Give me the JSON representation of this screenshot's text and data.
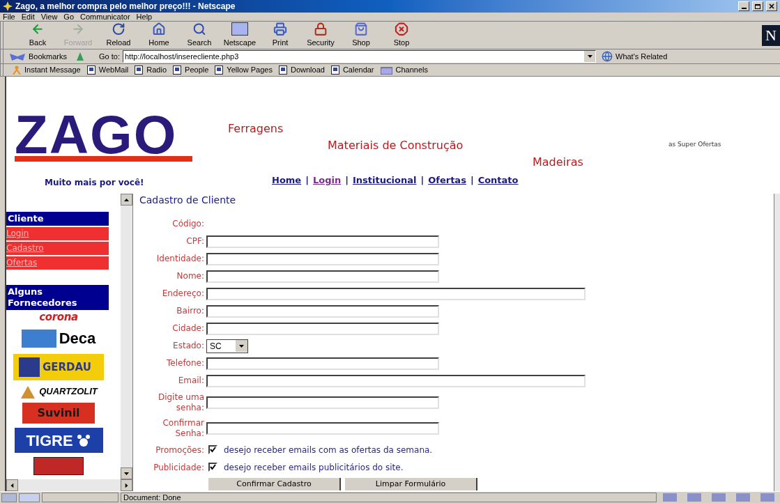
{
  "window": {
    "title": "Zago, a melhor compra pelo melhor preço!!! - Netscape"
  },
  "menu": [
    "File",
    "Edit",
    "View",
    "Go",
    "Communicator",
    "Help"
  ],
  "toolbar": [
    {
      "label": "Back",
      "disabled": false
    },
    {
      "label": "Forward",
      "disabled": true
    },
    {
      "label": "Reload",
      "disabled": false
    },
    {
      "label": "Home",
      "disabled": false
    },
    {
      "label": "Search",
      "disabled": false
    },
    {
      "label": "Netscape",
      "disabled": false
    },
    {
      "label": "Print",
      "disabled": false
    },
    {
      "label": "Security",
      "disabled": false
    },
    {
      "label": "Shop",
      "disabled": false
    },
    {
      "label": "Stop",
      "disabled": false
    }
  ],
  "brand_mark": "N",
  "location": {
    "bookmarks": "Bookmarks",
    "label": "Go to:",
    "url": "http://localhost/inserecliente.php3",
    "related": "What's Related"
  },
  "personal_toolbar": [
    {
      "label": "Instant Message",
      "kind": "person"
    },
    {
      "label": "WebMail",
      "kind": "page"
    },
    {
      "label": "Radio",
      "kind": "page"
    },
    {
      "label": "People",
      "kind": "page"
    },
    {
      "label": "Yellow Pages",
      "kind": "page"
    },
    {
      "label": "Download",
      "kind": "page"
    },
    {
      "label": "Calendar",
      "kind": "page"
    },
    {
      "label": "Channels",
      "kind": "folder"
    }
  ],
  "header": {
    "logo": "ZAGO",
    "taglines": [
      "Ferragens",
      "Materiais de Construção",
      "Madeiras"
    ],
    "banner": "as Super Ofertas",
    "slogan": "Muito mais por você!",
    "nav": [
      {
        "label": "Home",
        "visited": false
      },
      {
        "label": "Login",
        "visited": true
      },
      {
        "label": "Institucional",
        "visited": false
      },
      {
        "label": "Ofertas",
        "visited": false
      },
      {
        "label": "Contato",
        "visited": false
      }
    ],
    "separator": "|"
  },
  "sidebar": {
    "sections": [
      {
        "title": "Cliente",
        "links": [
          "Login",
          "Cadastro",
          "Ofertas"
        ]
      },
      {
        "title": "Alguns Fornecedores"
      }
    ],
    "suppliers": [
      {
        "name": "corona",
        "kind": "corona"
      },
      {
        "name": "Deca",
        "kind": "deca"
      },
      {
        "name": "GERDAU",
        "kind": "gerdau"
      },
      {
        "name": "QUARTZOLIT",
        "kind": "quartzolit"
      },
      {
        "name": "Suvinil",
        "kind": "suvinil"
      },
      {
        "name": "TIGRE",
        "kind": "tigre"
      },
      {
        "kind": "partial"
      }
    ]
  },
  "form": {
    "title": "Cadastro de Cliente",
    "fields": [
      {
        "label": "Código:",
        "kind": "none"
      },
      {
        "label": "CPF:",
        "kind": "text",
        "wide": false
      },
      {
        "label": "Identidade:",
        "kind": "text",
        "wide": false
      },
      {
        "label": "Nome:",
        "kind": "text",
        "wide": false
      },
      {
        "label": "Endereço:",
        "kind": "text",
        "wide": true
      },
      {
        "label": "Bairro:",
        "kind": "text",
        "wide": false
      },
      {
        "label": "Cidade:",
        "kind": "text",
        "wide": false
      },
      {
        "label": "Estado:",
        "kind": "select",
        "value": "SC"
      },
      {
        "label": "Telefone:",
        "kind": "text",
        "wide": false
      },
      {
        "label": "Email:",
        "kind": "text",
        "wide": true
      },
      {
        "label": "Digite uma senha:",
        "kind": "text",
        "wide": false
      },
      {
        "label": "Confirmar Senha:",
        "kind": "text",
        "wide": false
      }
    ],
    "checkboxes": [
      {
        "label": "Promoções:",
        "text": "desejo receber emails com as ofertas da semana.",
        "checked": true
      },
      {
        "label": "Publicidade:",
        "text": "desejo receber emails publicitários do site.",
        "checked": true
      }
    ],
    "buttons": [
      "Confirmar Cadastro",
      "Limpar Formulário"
    ]
  },
  "status": "Document: Done"
}
